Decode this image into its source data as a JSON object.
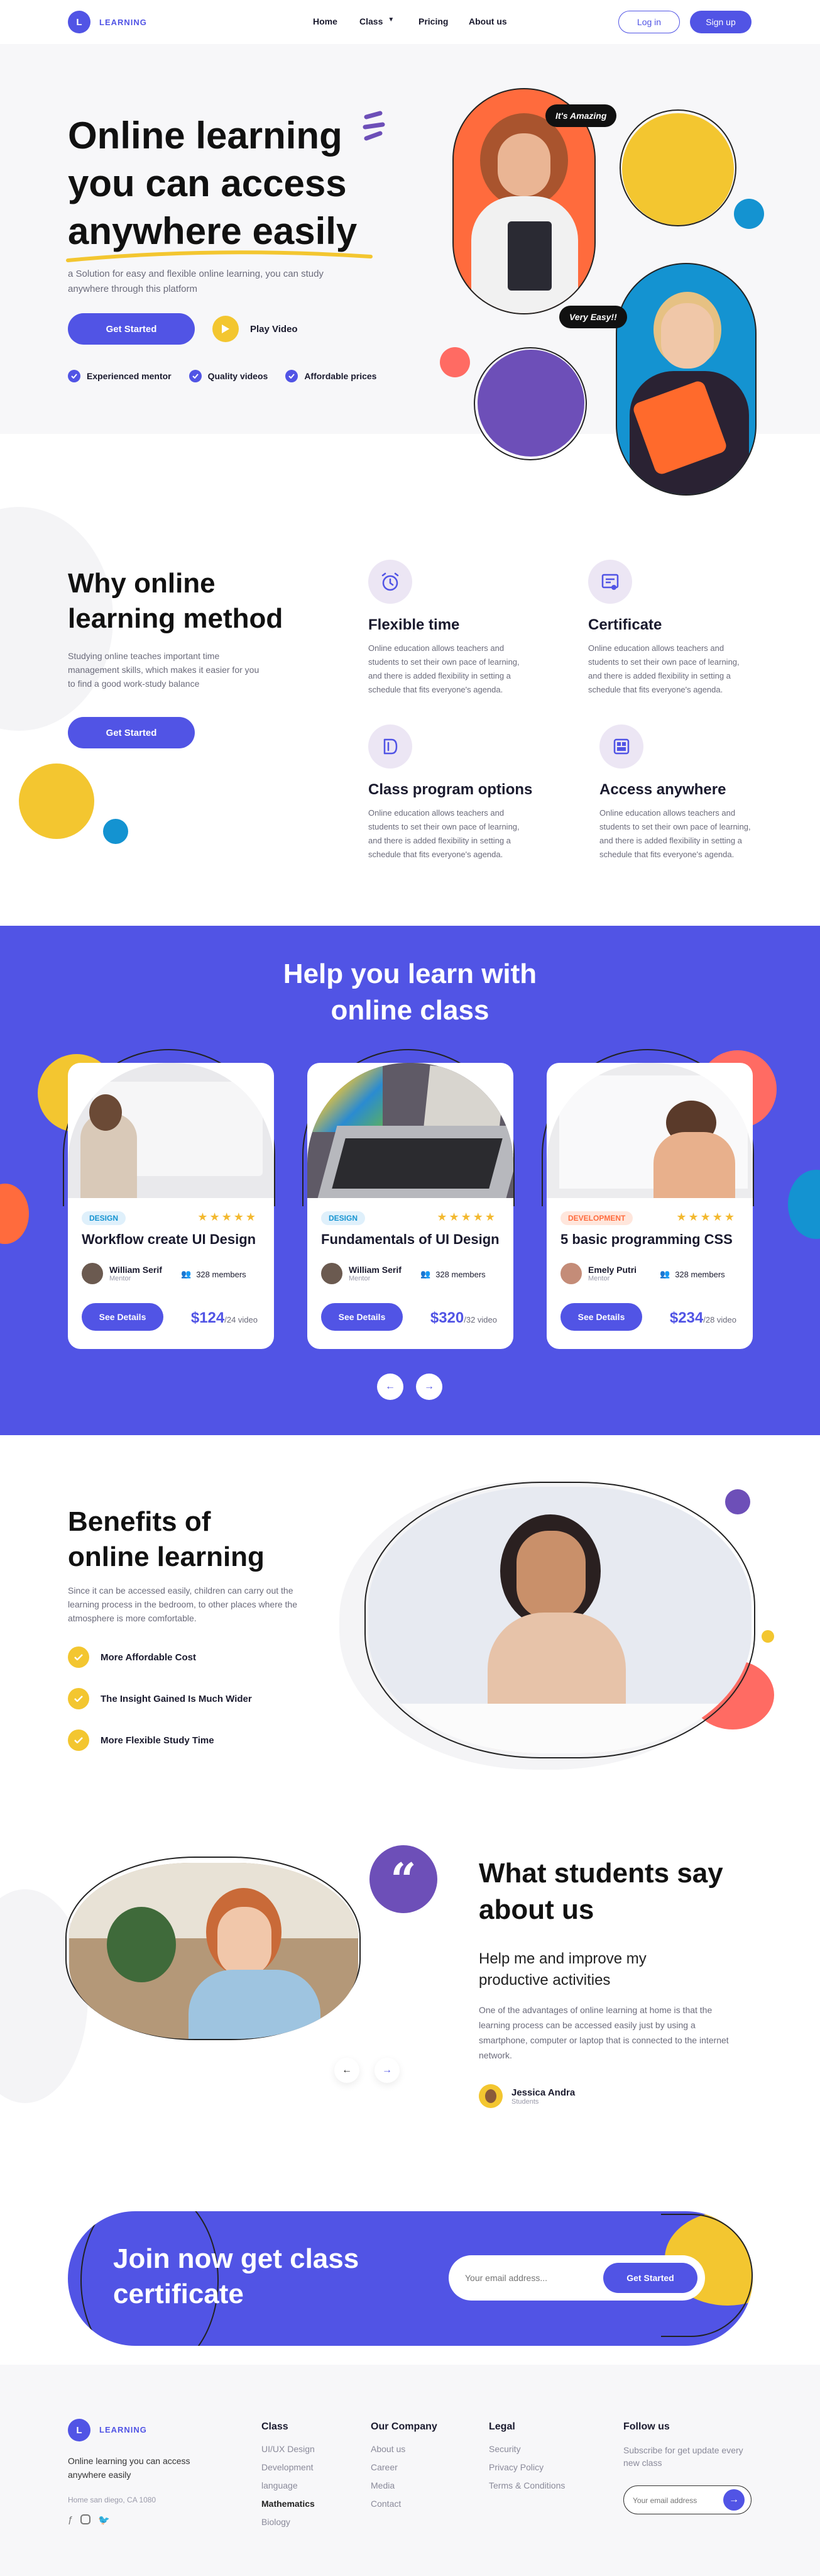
{
  "nav": {
    "logo_letter": "L",
    "brand": "LEARNING",
    "links": [
      "Home",
      "Class",
      "Pricing",
      "About us"
    ],
    "login": "Log in",
    "signup": "Sign up"
  },
  "hero": {
    "title_line1": "Online learning",
    "title_line2": "you can access",
    "title_line3": "anywhere easily",
    "subtitle": "a Solution for easy and flexible online learning, you can study anywhere through this platform",
    "cta": "Get Started",
    "play": "Play Video",
    "features": [
      "Experienced mentor",
      "Quality videos",
      "Affordable prices"
    ],
    "bubble1": "It's Amazing",
    "bubble2": "Very Easy!!"
  },
  "why": {
    "title_line1": "Why online",
    "title_line2": "learning method",
    "desc": "Studying online teaches important time management skills, which makes it easier for you to find a good work-study balance",
    "cta": "Get Started",
    "features": [
      {
        "title": "Flexible time",
        "desc": "Online education allows teachers and students to set their own pace of learning, and there is added flexibility in setting a schedule that fits everyone's agenda."
      },
      {
        "title": "Certificate",
        "desc": "Online education allows teachers and students to set their own pace of learning, and there is added flexibility in setting a schedule that fits everyone's agenda."
      },
      {
        "title": "Class program options",
        "desc": "Online education allows teachers and students to set their own pace of learning, and there is added flexibility in setting a schedule that fits everyone's agenda."
      },
      {
        "title": "Access anywhere",
        "desc": "Online education allows teachers and students to set their own pace of learning, and there is added flexibility in setting a schedule that fits everyone's agenda."
      }
    ]
  },
  "classes": {
    "title_line1": "Help you learn with",
    "title_line2": "online class",
    "cards": [
      {
        "tag": "DESIGN",
        "title": "Workflow create UI Design",
        "mentor": "William Serif",
        "role": "Mentor",
        "members": "328 members",
        "btn": "See Details",
        "price": "$124",
        "unit": "/24 video"
      },
      {
        "tag": "DESIGN",
        "title": "Fundamentals of UI Design",
        "mentor": "William Serif",
        "role": "Mentor",
        "members": "328 members",
        "btn": "See Details",
        "price": "$320",
        "unit": "/32 video"
      },
      {
        "tag": "DEVELOPMENT",
        "title": "5 basic programming CSS",
        "mentor": "Emely Putri",
        "role": "Mentor",
        "members": "328 members",
        "btn": "See Details",
        "price": "$234",
        "unit": "/28 video"
      }
    ],
    "stars": "★★★★★"
  },
  "benefits": {
    "title_line1": "Benefits of",
    "title_line2": "online learning",
    "desc": "Since it can be accessed easily, children can carry out the learning process in the bedroom, to other places where the atmosphere is more comfortable.",
    "items": [
      "More Affordable Cost",
      "The Insight Gained Is Much Wider",
      "More Flexible Study Time"
    ]
  },
  "testimonial": {
    "title_line1": "What students say",
    "title_line2": "about us",
    "quote_title": "Help me and improve my productive activities",
    "quote": "One of the advantages of online learning at home is that the learning process can be accessed easily just by using a smartphone, computer or laptop that is connected to the internet network.",
    "name": "Jessica Andra",
    "role": "Students",
    "quote_mark": "“"
  },
  "cta": {
    "title_line1": "Join now get class",
    "title_line2": "certificate",
    "placeholder": "Your email address...",
    "button": "Get Started"
  },
  "footer": {
    "brand": "LEARNING",
    "tagline": "Online learning you can access anywhere easily",
    "address": "Home san diego, CA 1080",
    "class_title": "Class",
    "class_items": [
      "UI/UX Design",
      "Development",
      "language",
      "Mathematics",
      "Biology"
    ],
    "company_title": "Our Company",
    "company_items": [
      "About us",
      "Career",
      "Media",
      "Contact"
    ],
    "legal_title": "Legal",
    "legal_items": [
      "Security",
      "Privacy Policy",
      "Terms & Conditions"
    ],
    "follow_title": "Follow us",
    "follow_desc": "Subscribe for get update every new class",
    "email_placeholder": "Your email address"
  },
  "colors": {
    "primary": "#5154e5",
    "yellow": "#f3c630",
    "orange": "#ff6b3d",
    "blue": "#1493d1",
    "purple": "#6d4fb8"
  }
}
